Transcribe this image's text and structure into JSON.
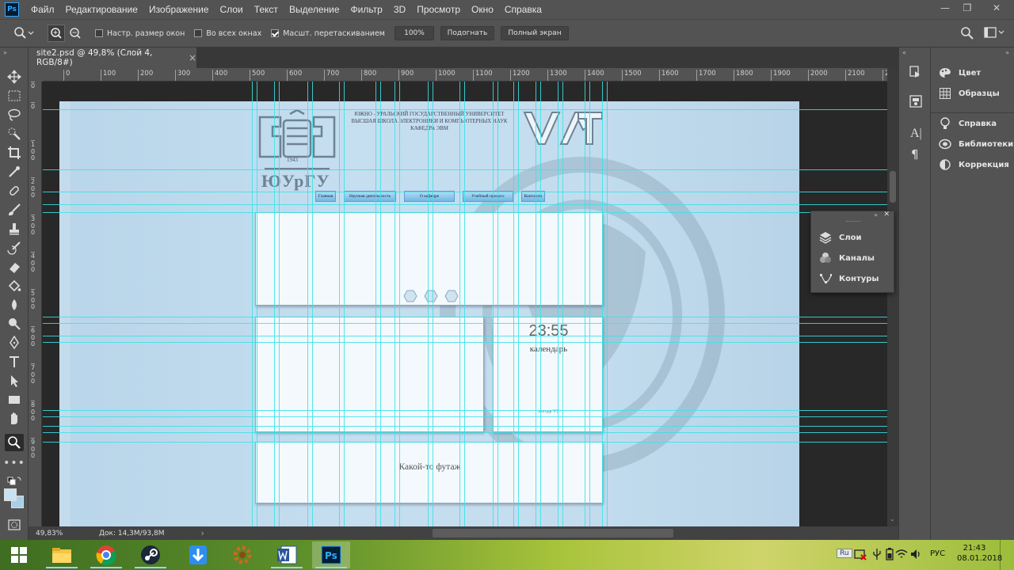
{
  "app": {
    "logo": "Ps"
  },
  "menu": [
    "Файл",
    "Редактирование",
    "Изображение",
    "Слои",
    "Текст",
    "Выделение",
    "Фильтр",
    "3D",
    "Просмотр",
    "Окно",
    "Справка"
  ],
  "window_controls": {
    "minimize": "—",
    "restore": "❐",
    "close": "✕"
  },
  "options": {
    "resize_windows": "Настр. размер окон",
    "all_windows": "Во всех окнах",
    "scrubby_zoom": "Масшт. перетаскиванием",
    "zoom_value": "100%",
    "fit_label": "Подогнать",
    "fullscreen_label": "Полный экран",
    "scrubby_checked": true
  },
  "document_tab": {
    "title": "site2.psd @ 49,8% (Слой 4, RGB/8#)",
    "close": "×"
  },
  "ruler_top": [
    "0",
    "100",
    "200",
    "300",
    "400",
    "500",
    "600",
    "700",
    "800",
    "900",
    "1000",
    "1100",
    "1200",
    "1300",
    "1400",
    "1500",
    "1600",
    "1700",
    "1800",
    "1900",
    "2000",
    "2100",
    "220"
  ],
  "ruler_left": [
    "0",
    "0",
    "1\n0\n0",
    "2\n0\n0",
    "3\n0\n0",
    "4\n0\n0",
    "5\n0\n0",
    "6\n0\n0",
    "7\n0\n0",
    "8\n0\n0",
    "9\n0\n0"
  ],
  "canvas": {
    "header_line1": "ЮЖНО - УРАЛЬСКИЙ ГОСУДАРСТВЕННЫЙ УНИВЕРСИТЕТ",
    "header_line2": "ВЫСШАЯ ШКОЛА ЭЛЕКТРОНИКИ И КОМПЬЮТЕРНЫХ НАУК",
    "header_line3": "КАФЕДРА ЭВМ",
    "logo_year": "1943",
    "logo_text": "ЮУрГУ",
    "nav": [
      "Главная",
      "Научная деятельность",
      "О кафедре",
      "Учебный процесс",
      "Контакты"
    ],
    "clock": "23:55",
    "calendar": "календарь",
    "weather": "погода VS",
    "footer": "Какой-то футаж"
  },
  "status": {
    "zoom": "49,83%",
    "doc": "Док: 14,3M/93,8M"
  },
  "panels_right": [
    "Цвет",
    "Образцы",
    "Справка",
    "Библиотеки",
    "Коррекция"
  ],
  "panels_float": [
    "Слои",
    "Каналы",
    "Контуры"
  ],
  "tray": {
    "lang_badge": "Ru",
    "lang": "РУС",
    "time": "21:43",
    "date": "08.01.2018"
  }
}
